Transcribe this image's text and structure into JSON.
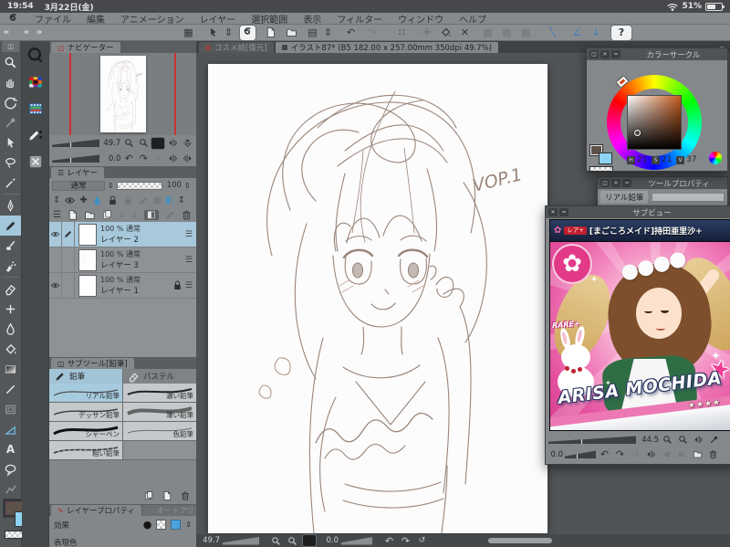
{
  "icons": {
    "collapse": "«",
    "expand": "»",
    "updown": "⇕",
    "grid": "▦",
    "save": "▤",
    "undo": "↶",
    "redo": "↷",
    "dots": "∷",
    "plus": "✚",
    "cross": "✕",
    "dim_box": "▩",
    "diag": "╲",
    "angle": "∠",
    "down_arrow": "↓",
    "chev_down": "▼",
    "fit": "",
    "reset": "↺",
    "rot_left": "↶",
    "rot_right": "↷",
    "menu": "☰",
    "circle": "●",
    "tone": "▦",
    "color_chip": "◧",
    "prev": "◀",
    "next": "▶",
    "flower": "✿",
    "sparkle": "✦",
    "close": "✕",
    "minimize": "━",
    "dock": "◫",
    "text_tool": "A"
  },
  "status_bar": {
    "time": "19:54",
    "date": "3月22日(金)",
    "battery_percent": "51%"
  },
  "menu_bar": {
    "items": [
      "ファイル",
      "編集",
      "アニメーション",
      "レイヤー",
      "選択範囲",
      "表示",
      "フィルター",
      "ウィンドウ",
      "ヘルプ"
    ]
  },
  "toolbar": {
    "help_label": "?"
  },
  "tab_strip": {
    "inactive_tab": "コスメ絵[復元]",
    "active_tab": "イラスト87* (B5 182.00 x 257.00mm 350dpi 49.7%)"
  },
  "navigator": {
    "title": "ナビゲーター",
    "zoom_value": "49.7",
    "rotation_value": "0.0"
  },
  "layer_panel": {
    "title": "レイヤー",
    "blend_mode": "通常",
    "opacity": "100",
    "layers": [
      {
        "info": "100 % 通常",
        "name": "レイヤー 2"
      },
      {
        "info": "100 % 通常",
        "name": "レイヤー 3"
      },
      {
        "info": "100 % 通常",
        "name": "レイヤー 1"
      }
    ]
  },
  "subtool_panel": {
    "title": "サブツール[鉛筆]",
    "tab_pencil": "鉛筆",
    "tab_pastel": "パステル",
    "items": [
      "リアル鉛筆",
      "濃い鉛筆",
      "デッサン鉛筆",
      "薄い鉛筆",
      "シャーペン",
      "色鉛筆",
      "粗い鉛筆"
    ]
  },
  "layer_property_panel": {
    "tab_active": "レイヤープロパティ",
    "tab_inactive": "オートアクション",
    "effect_label": "効果",
    "color_mode_label": "表現色"
  },
  "color_circle": {
    "title": "カラーサークル",
    "h_label": "H",
    "s_label": "S",
    "v_label": "V",
    "h": "21",
    "s": "21",
    "v": "37",
    "foreground_color": "#5e514a",
    "background_color": "#8fd3f2",
    "current_hue": "#c25a1e"
  },
  "tool_property": {
    "title": "ツールプロパティ",
    "tool_name": "リアル鉛筆"
  },
  "subview": {
    "title": "サブビュー",
    "zoom_value": "44.5",
    "rotation_value": "0.0",
    "card": {
      "rarity_badge": "レア+",
      "title_jp": "[まごころメイド]持田亜里沙+",
      "rare_label": "RARE+",
      "name_en": "ARISA MOCHIDA",
      "big_star": "★",
      "stars": "★★★★"
    }
  },
  "canvas": {
    "handwritten_note": "VOP.1"
  },
  "bottom_bar": {
    "zoom_value": "49.7",
    "rotation_value": "0.0"
  }
}
